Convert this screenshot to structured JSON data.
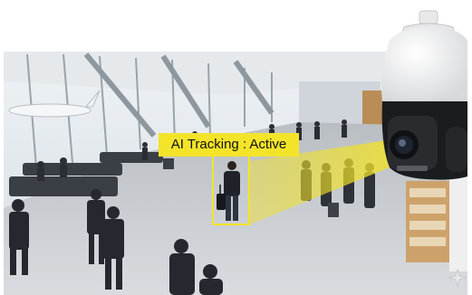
{
  "overlay": {
    "label_text": "AI Tracking : Active"
  },
  "colors": {
    "highlight": "#f3e42a",
    "camera_white": "#f2f2f2",
    "camera_dark": "#1b1c1f",
    "sky": "#dfe6ec",
    "floor": "#c9ccd0"
  },
  "icons": {
    "corner_mark": "sparkle-icon"
  }
}
